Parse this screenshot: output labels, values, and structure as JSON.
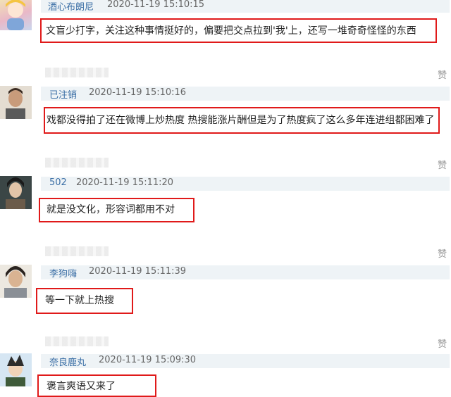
{
  "like_label": "赞",
  "comments": [
    {
      "username": "酒心布朗尼",
      "time": "2020-11-19 15:10:15",
      "text": "文盲少打字，关注这种事情挺好的，偏要把交点拉到'我'上，还写一堆奇奇怪怪的东西"
    },
    {
      "username": "已注销",
      "time": "2020-11-19 15:10:16",
      "text": "戏都没得拍了还在微博上炒热度 热搜能涨片酬但是为了热度疯了这么多年连进组都困难了"
    },
    {
      "username": "502",
      "time": "2020-11-19 15:11:20",
      "text": "就是没文化，形容词都用不对"
    },
    {
      "username": "李狗嗨",
      "time": "2020-11-19 15:11:39",
      "text": "等一下就上热搜"
    },
    {
      "username": "奈良鹿丸",
      "time": "2020-11-19 15:09:30",
      "text": "褒言爽语又来了"
    }
  ]
}
